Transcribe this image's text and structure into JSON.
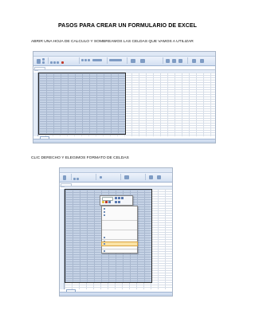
{
  "document": {
    "title": "PASOS PARA CREAR UN FORMULARIO DE EXCEL",
    "step1": "ABRIR UNA HOJA DE CALCULO Y SOMBREAMOS LAS CELDAS QUE VAMOS A UTILIZAR",
    "step2": "CLIC DERECHO Y ELEGIMOS FORMATO DE CELDAS"
  },
  "colors": {
    "ribbon": "#d3e0f2",
    "selection_fill": "#c6d3e6",
    "menu_highlight": "#fbe3a6"
  },
  "screenshot1": {
    "type": "excel-window",
    "selected_range_shaded": true
  },
  "screenshot2": {
    "type": "excel-window",
    "context_menu_open": true,
    "context_menu_items": 14,
    "highlighted_item_index": 10
  }
}
